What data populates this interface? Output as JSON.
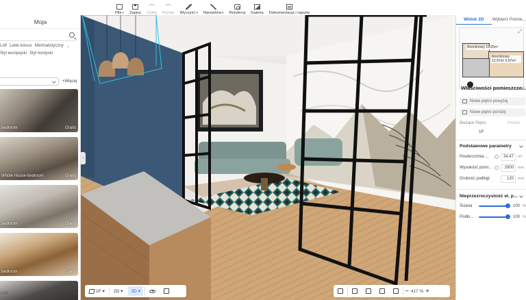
{
  "toolbar": {
    "items": [
      {
        "label": "Plik",
        "icon": "file-icon",
        "dropdown": true,
        "enabled": true
      },
      {
        "label": "Zapisz",
        "icon": "save-icon",
        "dropdown": false,
        "enabled": true
      },
      {
        "label": "Cofnij",
        "icon": "undo-icon",
        "dropdown": false,
        "enabled": false
      },
      {
        "label": "Ponów",
        "icon": "redo-icon",
        "dropdown": false,
        "enabled": false
      },
      {
        "label": "Wyczyść",
        "icon": "clear-icon",
        "dropdown": true,
        "enabled": true
      },
      {
        "label": "Narzędzia",
        "icon": "tools-icon",
        "dropdown": true,
        "enabled": true
      },
      {
        "label": "Renderuj",
        "icon": "camera-icon",
        "dropdown": false,
        "enabled": true
      },
      {
        "label": "Galeria",
        "icon": "gallery-icon",
        "dropdown": false,
        "enabled": true
      },
      {
        "label": "Dokumentacja i raporty",
        "icon": "document-icon",
        "dropdown": false,
        "enabled": true
      }
    ]
  },
  "left_panel": {
    "title": "Moja",
    "chip_rows": [
      [
        "Loft",
        "Lekki luksus",
        "Minimalistyczny"
      ],
      [
        "Styl europejski",
        "Styl nordycki"
      ]
    ],
    "filter_more": "+Więcej",
    "cards": [
      {
        "label": "bedroom",
        "badge": "Gratis"
      },
      {
        "label": "Whole House-bedroom",
        "badge": "Gratis"
      },
      {
        "label": "bedroom",
        "badge": "Gratis"
      },
      {
        "label": "bedroom",
        "badge": "Gratis"
      },
      {
        "label": "",
        "badge": ""
      }
    ],
    "pager": "1/24"
  },
  "right_panel": {
    "tabs": [
      {
        "label": "Widok 2D",
        "active": true
      },
      {
        "label": "Wybierz Pomie...",
        "active": false
      }
    ],
    "minimap_tags": [
      "Anonimowy 19.85m²",
      "Anonimowy 13.97m² 6.97m²"
    ],
    "properties_title": "Właściwości pomieszcze...",
    "floor_buttons": [
      "Nowe piętro powyżej",
      "Nowe piętro poniżej"
    ],
    "current_floor_label": "Bieżące Piętro",
    "current_floor_right": "Poniże",
    "current_floor_value": "1F",
    "basic_params_title": "Podstawowe parametry",
    "params": [
      {
        "label": "Powierzchnia ...",
        "value": "34.47",
        "unit": "m²"
      },
      {
        "label": "Wysokość pomi...",
        "value": "2800",
        "unit": "mm"
      },
      {
        "label": "Grubość podłogi",
        "value": "120",
        "unit": "mm"
      }
    ],
    "opacity_title": "Nieprzezroczystość el. p...",
    "opacity": [
      {
        "label": "Ściana",
        "value": "100",
        "unit": "%"
      },
      {
        "label": "Podło...",
        "value": "100",
        "unit": "%"
      }
    ]
  },
  "bottom_bar": {
    "floor": "1F",
    "view_2d": "2D",
    "view_3d": "3D",
    "zoom": "417",
    "zoom_unit": "%"
  },
  "colors": {
    "accent": "#2b6fd6",
    "wall_blue": "#3a5878",
    "floor_wood": "#c9a274"
  }
}
